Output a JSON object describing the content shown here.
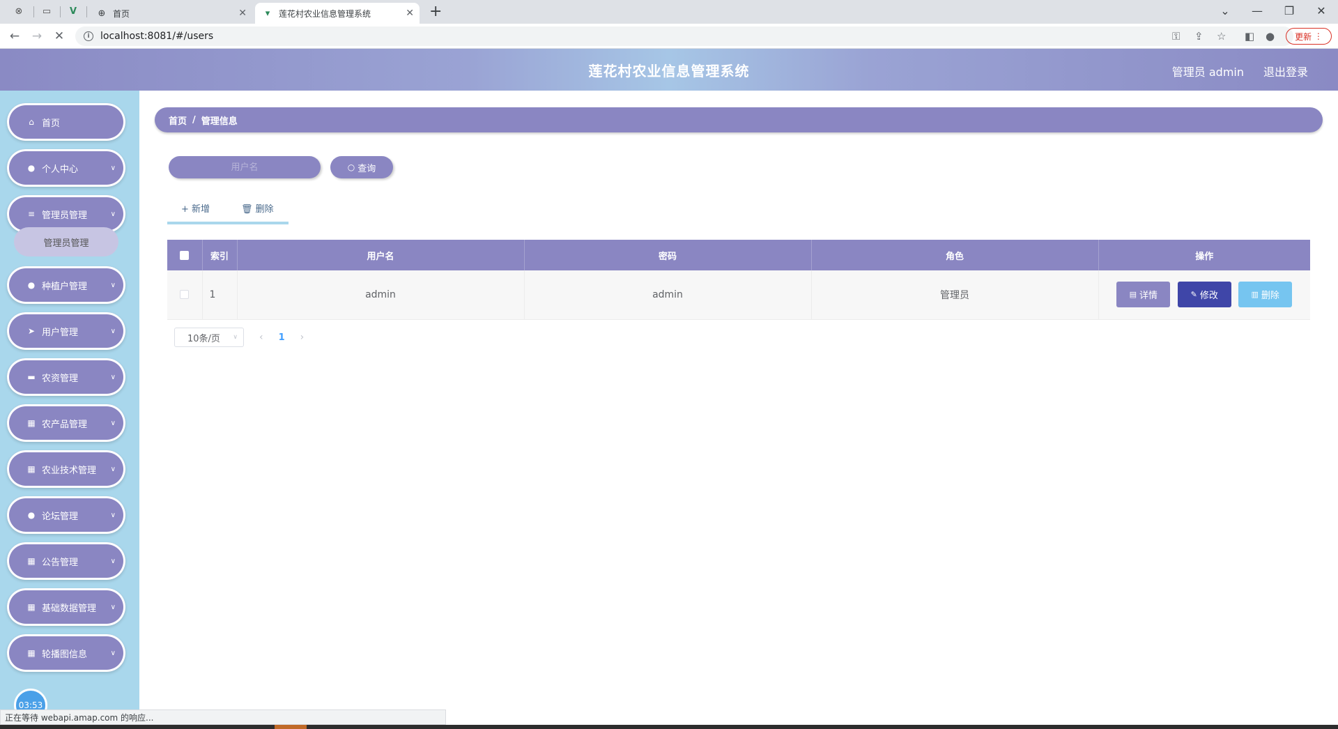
{
  "browser": {
    "tabs": [
      {
        "title": "首页",
        "icon": "globe-icon"
      },
      {
        "title": "莲花村农业信息管理系统",
        "icon": "vue-logo-icon"
      }
    ],
    "url": "localhost:8081/#/users",
    "update_label": "更新"
  },
  "header": {
    "title": "莲花村农业信息管理系统",
    "user": "管理员 admin",
    "logout": "退出登录"
  },
  "sidebar": {
    "items": [
      {
        "label": "首页",
        "icon": "home-icon"
      },
      {
        "label": "个人中心",
        "icon": "user-icon"
      },
      {
        "label": "管理员管理",
        "icon": "list-icon"
      },
      {
        "label": "种植户管理",
        "icon": "user-icon"
      },
      {
        "label": "用户管理",
        "icon": "send-icon"
      },
      {
        "label": "农资管理",
        "icon": "briefcase-icon"
      },
      {
        "label": "农产品管理",
        "icon": "grid-icon"
      },
      {
        "label": "农业技术管理",
        "icon": "grid-icon"
      },
      {
        "label": "论坛管理",
        "icon": "user-icon"
      },
      {
        "label": "公告管理",
        "icon": "grid-icon"
      },
      {
        "label": "基础数据管理",
        "icon": "grid-icon"
      },
      {
        "label": "轮播图信息",
        "icon": "grid-icon"
      }
    ],
    "submenu_label": "管理员管理",
    "clock": "03:53"
  },
  "breadcrumb": {
    "home": "首页",
    "separator": "/",
    "current": "管理信息"
  },
  "search": {
    "placeholder": "用户名",
    "query_label": "查询"
  },
  "actions": {
    "add_label": "新增",
    "delete_label": "删除"
  },
  "table": {
    "columns": [
      "索引",
      "用户名",
      "密码",
      "角色",
      "操作"
    ],
    "rows": [
      {
        "index": "1",
        "username": "admin",
        "password": "admin",
        "role": "管理员"
      }
    ],
    "row_actions": {
      "detail": "详情",
      "edit": "修改",
      "delete": "删除"
    }
  },
  "pagination": {
    "page_size": "10条/页",
    "current_page": "1"
  },
  "status_bar": "正在等待 webapi.amap.com 的响应...",
  "colors": {
    "primary": "#8a86c2",
    "sidebar_bg": "#a9d7ec",
    "edit_btn": "#3f46a8",
    "delete_btn": "#76c5f0"
  }
}
